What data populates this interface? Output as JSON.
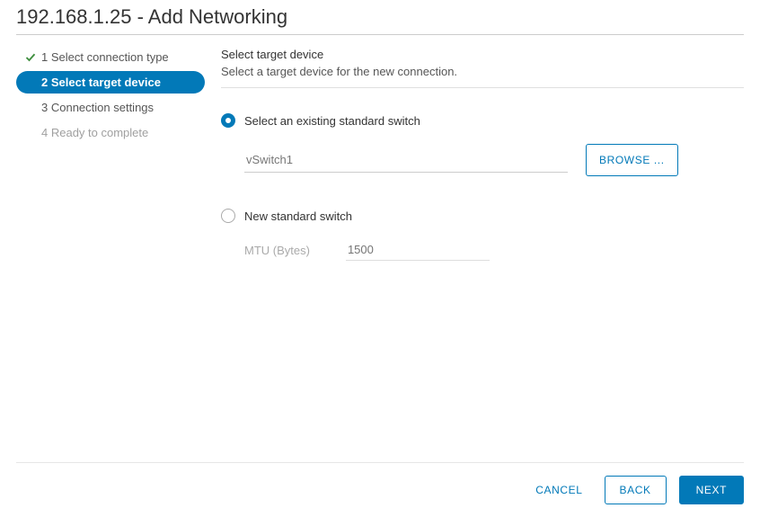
{
  "header": {
    "title": "192.168.1.25 - Add Networking"
  },
  "sidebar": {
    "steps": [
      {
        "label": "1 Select connection type"
      },
      {
        "label": "2 Select target device"
      },
      {
        "label": "3 Connection settings"
      },
      {
        "label": "4 Ready to complete"
      }
    ]
  },
  "main": {
    "section_title": "Select target device",
    "section_subtitle": "Select a target device for the new connection.",
    "option_existing": "Select an existing standard switch",
    "switch_value": "vSwitch1",
    "browse_label": "BROWSE ...",
    "option_new": "New standard switch",
    "mtu_label": "MTU (Bytes)",
    "mtu_placeholder": "1500"
  },
  "footer": {
    "cancel_label": "CANCEL",
    "back_label": "BACK",
    "next_label": "NEXT"
  }
}
